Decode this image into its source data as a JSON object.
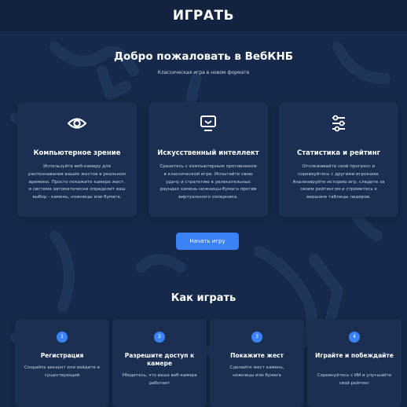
{
  "header": {
    "brand": "ИГРАТЬ"
  },
  "hero": {
    "title": "Добро пожаловать в ВебКНБ",
    "subtitle": "Классическая игра в новом формате"
  },
  "features": [
    {
      "icon": "eye-icon",
      "title": "Компьютерное зрение",
      "description": "Используйте веб-камеру для распознавания ваших жестов в реальном времени. Просто покажите камере жест, и система автоматически определит ваш выбор - камень, ножницы или бумага."
    },
    {
      "icon": "monitor-icon",
      "title": "Искусственный интеллект",
      "description": "Сразитесь с компьютерным противником в классической игре. Испытайте свою удачу и стратегию в увлекательных раундах камень-ножницы-бумага против виртуального соперника."
    },
    {
      "icon": "sliders-icon",
      "title": "Статистика и рейтинг",
      "description": "Отслеживайте свой прогресс и соревнуйтесь с другими игроками. Анализируйте историю игр, следите за своим рейтингом и стремитесь к вершине таблицы лидеров."
    }
  ],
  "cta": {
    "label": "Начать игру"
  },
  "how_to": {
    "title": "Как играть",
    "steps": [
      {
        "number": "1",
        "title": "Регистрация",
        "description": "Создайте аккаунт или войдите в существующий"
      },
      {
        "number": "2",
        "title": "Разрешите доступ к камере",
        "description": "Убедитесь, что ваша веб-камера работает"
      },
      {
        "number": "3",
        "title": "Покажите жест",
        "description": "Сделайте жест камень, ножницы или бумага"
      },
      {
        "number": "4",
        "title": "Играйте и побеждайте",
        "description": "Соревнуйтесь с ИИ и улучшайте свой рейтинг"
      }
    ]
  },
  "colors": {
    "background": "#16294a",
    "card": "#1b2f52",
    "accent": "#3b82f6",
    "muted_text": "#c9d3e6"
  }
}
